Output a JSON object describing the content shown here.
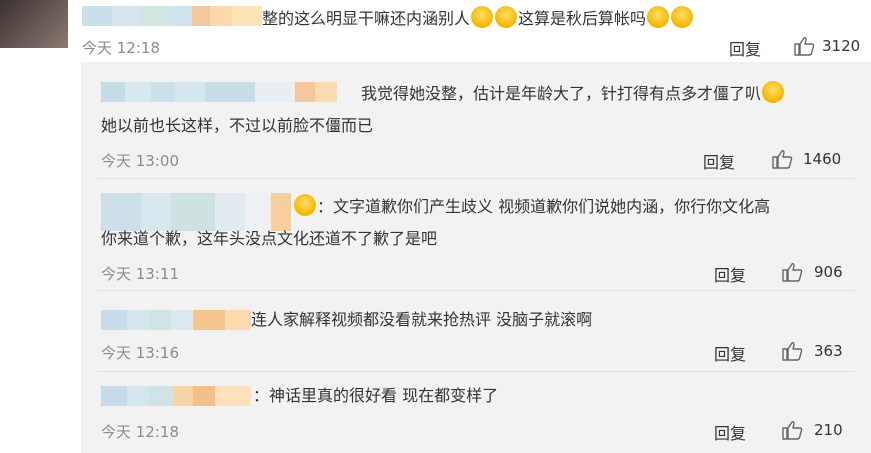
{
  "top_comment": {
    "text_before": "整的这么明显干嘛还内涵别人",
    "text_mid": "这算是秋后算帐吗",
    "time": "今天 12:18",
    "reply_label": "回复",
    "likes": "3120"
  },
  "replies": [
    {
      "text_line1": "我觉得她没整，估计是年龄大了，针打得有点多才僵了叭",
      "text_line2": "她以前也长这样，不过以前脸不僵而已",
      "time": "今天 13:00",
      "reply_label": "回复",
      "likes": "1460"
    },
    {
      "text_line1": "：文字道歉你们产生歧义 视频道歉你们说她内涵，你行你文化高",
      "text_line2": "你来道个歉，这年头没点文化还道不了歉了是吧",
      "time": "今天 13:11",
      "reply_label": "回复",
      "likes": "906"
    },
    {
      "text_line1": "连人家解释视频都没看就来抢热评 没脑子就滚啊",
      "time": "今天 13:16",
      "reply_label": "回复",
      "likes": "363"
    },
    {
      "text_line1": "：神话里真的很好看 现在都变样了",
      "time": "今天 12:18",
      "reply_label": "回复",
      "likes": "210"
    }
  ],
  "icons": {
    "thumb": "thumbs-up-icon",
    "emoji": "laughing-emoji-icon"
  },
  "colors": {
    "reply_bg": "#f2f2f2",
    "muted_text": "#8c8c8c"
  }
}
